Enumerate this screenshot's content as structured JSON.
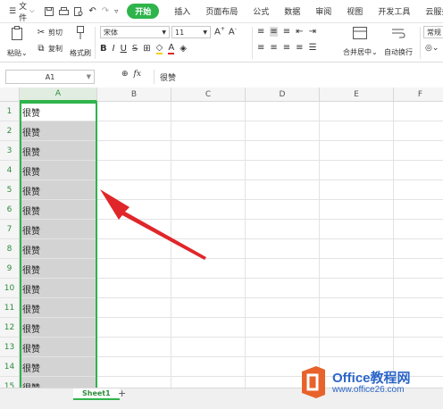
{
  "menubar": {
    "file_label": "文件",
    "tabs": [
      "开始",
      "插入",
      "页面布局",
      "公式",
      "数据",
      "审阅",
      "视图",
      "开发工具",
      "云服务"
    ]
  },
  "ribbon": {
    "paste_label": "粘贴",
    "cut_label": "剪切",
    "copy_label": "复制",
    "format_painter_label": "格式刷",
    "font_name": "宋体",
    "font_size": "11",
    "merge_center_label": "合并居中",
    "wrap_text_label": "自动换行",
    "number_format": "常规"
  },
  "formula_bar": {
    "cell_ref": "A1",
    "fx_label": "fx",
    "content": "很赞"
  },
  "grid": {
    "columns": [
      "A",
      "B",
      "C",
      "D",
      "E",
      "F"
    ],
    "rows": [
      "1",
      "2",
      "3",
      "4",
      "5",
      "6",
      "7",
      "8",
      "9",
      "10",
      "11",
      "12",
      "13",
      "14",
      "15"
    ],
    "cells_a": [
      "很赞",
      "很赞",
      "很赞",
      "很赞",
      "很赞",
      "很赞",
      "很赞",
      "很赞",
      "很赞",
      "很赞",
      "很赞",
      "很赞",
      "很赞",
      "很赞",
      "很赞"
    ]
  },
  "sheet_tabs": {
    "active": "Sheet1",
    "add": "+"
  },
  "watermark": {
    "title": "Office教程网",
    "url": "www.office26.com"
  },
  "colors": {
    "accent": "#2fb44b",
    "selection_fill": "#d3d3d3",
    "arrow": "#e0262a",
    "watermark": "#2b66c8",
    "logo": "#e8622b"
  }
}
